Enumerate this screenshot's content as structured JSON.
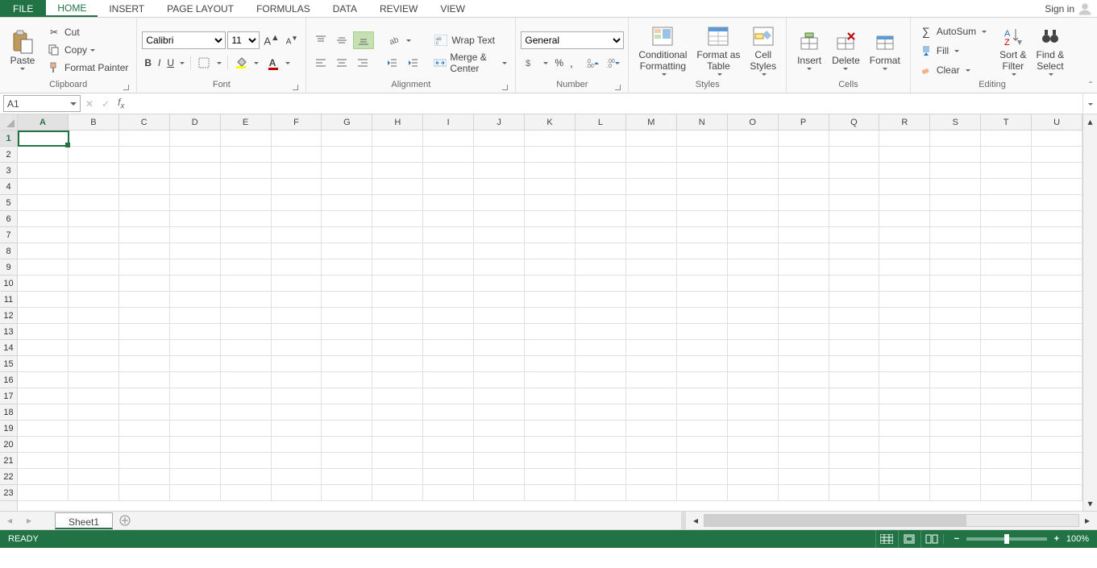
{
  "tabs": {
    "file": "FILE",
    "list": [
      "HOME",
      "INSERT",
      "PAGE LAYOUT",
      "FORMULAS",
      "DATA",
      "REVIEW",
      "VIEW"
    ],
    "active_index": 0,
    "signin": "Sign in"
  },
  "ribbon": {
    "clipboard": {
      "caption": "Clipboard",
      "paste": "Paste",
      "cut": "Cut",
      "copy": "Copy",
      "format_painter": "Format Painter"
    },
    "font": {
      "caption": "Font",
      "name": "Calibri",
      "size": "11"
    },
    "alignment": {
      "caption": "Alignment",
      "wrap": "Wrap Text",
      "merge": "Merge & Center"
    },
    "number": {
      "caption": "Number",
      "format": "General"
    },
    "styles": {
      "caption": "Styles",
      "conditional1": "Conditional",
      "conditional2": "Formatting",
      "table1": "Format as",
      "table2": "Table",
      "cell1": "Cell",
      "cell2": "Styles"
    },
    "cells": {
      "caption": "Cells",
      "insert": "Insert",
      "delete": "Delete",
      "format": "Format"
    },
    "editing": {
      "caption": "Editing",
      "autosum": "AutoSum",
      "fill": "Fill",
      "clear": "Clear",
      "sort1": "Sort &",
      "sort2": "Filter",
      "find1": "Find &",
      "find2": "Select"
    }
  },
  "formula_bar": {
    "namebox": "A1",
    "formula": ""
  },
  "grid": {
    "columns": [
      "A",
      "B",
      "C",
      "D",
      "E",
      "F",
      "G",
      "H",
      "I",
      "J",
      "K",
      "L",
      "M",
      "N",
      "O",
      "P",
      "Q",
      "R",
      "S",
      "T",
      "U"
    ],
    "rows": [
      1,
      2,
      3,
      4,
      5,
      6,
      7,
      8,
      9,
      10,
      11,
      12,
      13,
      14,
      15,
      16,
      17,
      18,
      19,
      20,
      21,
      22,
      23
    ],
    "active_cell": "A1"
  },
  "sheets": {
    "active": "Sheet1"
  },
  "status": {
    "ready": "READY",
    "zoom": "100%"
  }
}
